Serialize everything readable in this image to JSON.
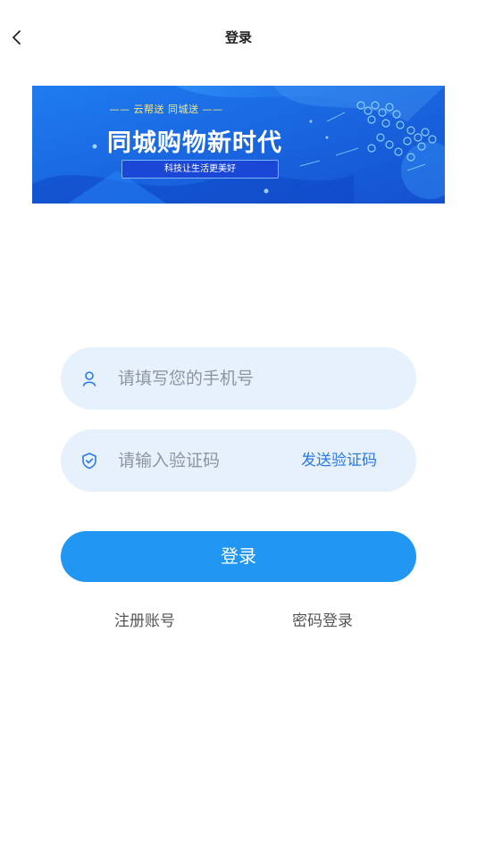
{
  "header": {
    "title": "登录",
    "back_icon": "chevron-left-icon"
  },
  "banner": {
    "tagline": "—— 云帮送 同城送 ——",
    "headline": "同城购物新时代",
    "slogan": "科技让生活更美好",
    "colors": {
      "background": "#1a6ee8",
      "background_dark": "#1550d0",
      "tagline": "#ffe97a"
    }
  },
  "form": {
    "phone": {
      "icon": "user-icon",
      "placeholder": "请填写您的手机号",
      "value": ""
    },
    "code": {
      "icon": "shield-check-icon",
      "placeholder": "请输入验证码",
      "value": "",
      "send_label": "发送验证码"
    },
    "login_label": "登录",
    "colors": {
      "field_background": "#e6f1fc",
      "accent": "#2196f3",
      "link_accent": "#2a78e6"
    }
  },
  "links": {
    "register": "注册账号",
    "password_login": "密码登录"
  }
}
